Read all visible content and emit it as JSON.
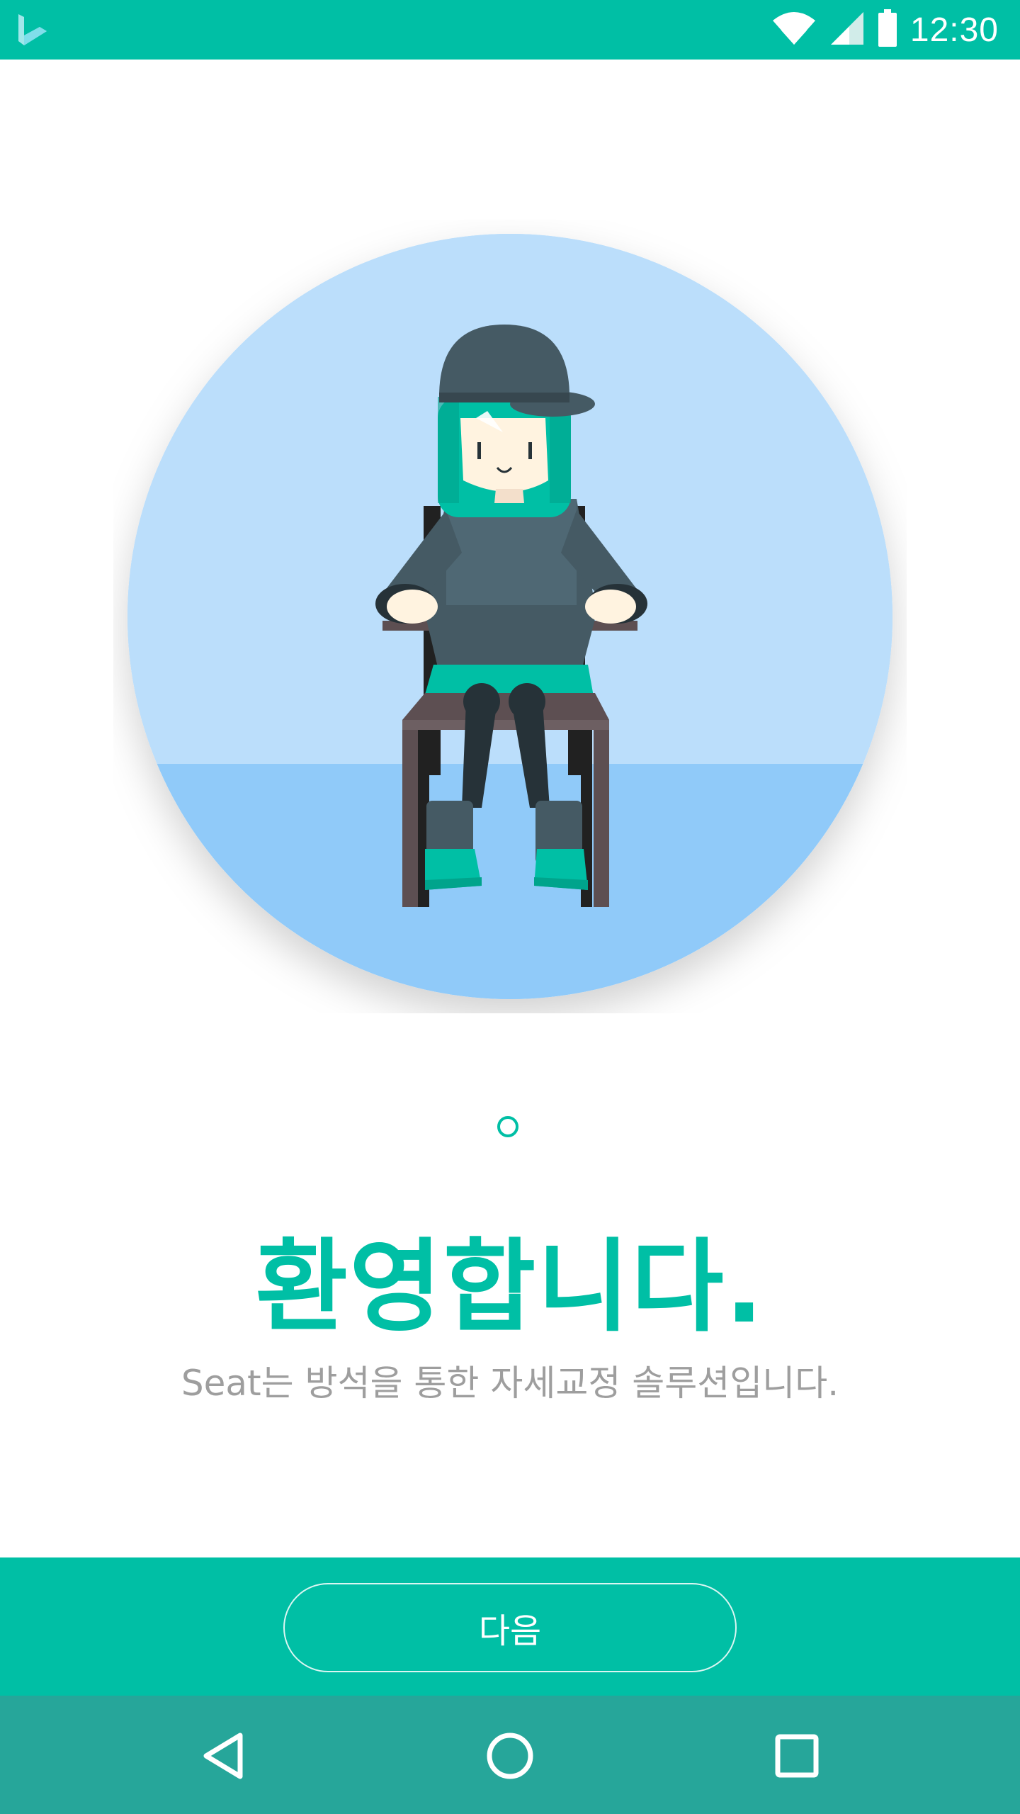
{
  "status_bar": {
    "time": "12:30",
    "icons": [
      "app-logo-icon",
      "wifi-icon",
      "signal-icon",
      "battery-icon"
    ]
  },
  "onboarding": {
    "page_indicator": {
      "current": 1,
      "total": 1
    },
    "title": "환영합니다.",
    "subtitle": "Seat는 방석을 통한 자세교정 솔루션입니다.",
    "next_button_label": "다음"
  },
  "nav_bar": {
    "icons": [
      "back-icon",
      "home-icon",
      "recents-icon"
    ]
  },
  "colors": {
    "accent": "#00BFA5",
    "nav_bar": "#26A69A",
    "sky": "#BBDEFB",
    "floor": "#90CAF9",
    "subtitle_text": "#9E9E9E"
  }
}
